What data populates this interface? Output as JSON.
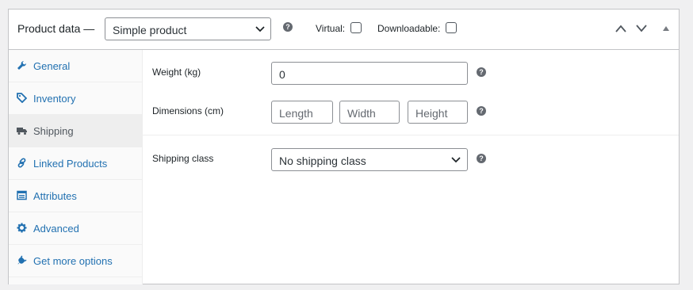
{
  "header": {
    "title": "Product data —",
    "product_type": "Simple product",
    "virtual_label": "Virtual:",
    "downloadable_label": "Downloadable:"
  },
  "sidebar": {
    "items": [
      {
        "label": "General",
        "icon": "wrench-icon"
      },
      {
        "label": "Inventory",
        "icon": "tag-icon"
      },
      {
        "label": "Shipping",
        "icon": "truck-icon",
        "active": true
      },
      {
        "label": "Linked Products",
        "icon": "link-icon"
      },
      {
        "label": "Attributes",
        "icon": "list-icon"
      },
      {
        "label": "Advanced",
        "icon": "gear-icon"
      },
      {
        "label": "Get more options",
        "icon": "plugin-icon"
      }
    ]
  },
  "shipping": {
    "weight_label": "Weight (kg)",
    "weight_placeholder": "0",
    "dimensions_label": "Dimensions (cm)",
    "length_placeholder": "Length",
    "width_placeholder": "Width",
    "height_placeholder": "Height",
    "shipping_class_label": "Shipping class",
    "shipping_class_value": "No shipping class"
  },
  "colors": {
    "link": "#2271b1",
    "border": "#c3c4c7",
    "active_tab_bg": "#eeeeee"
  }
}
